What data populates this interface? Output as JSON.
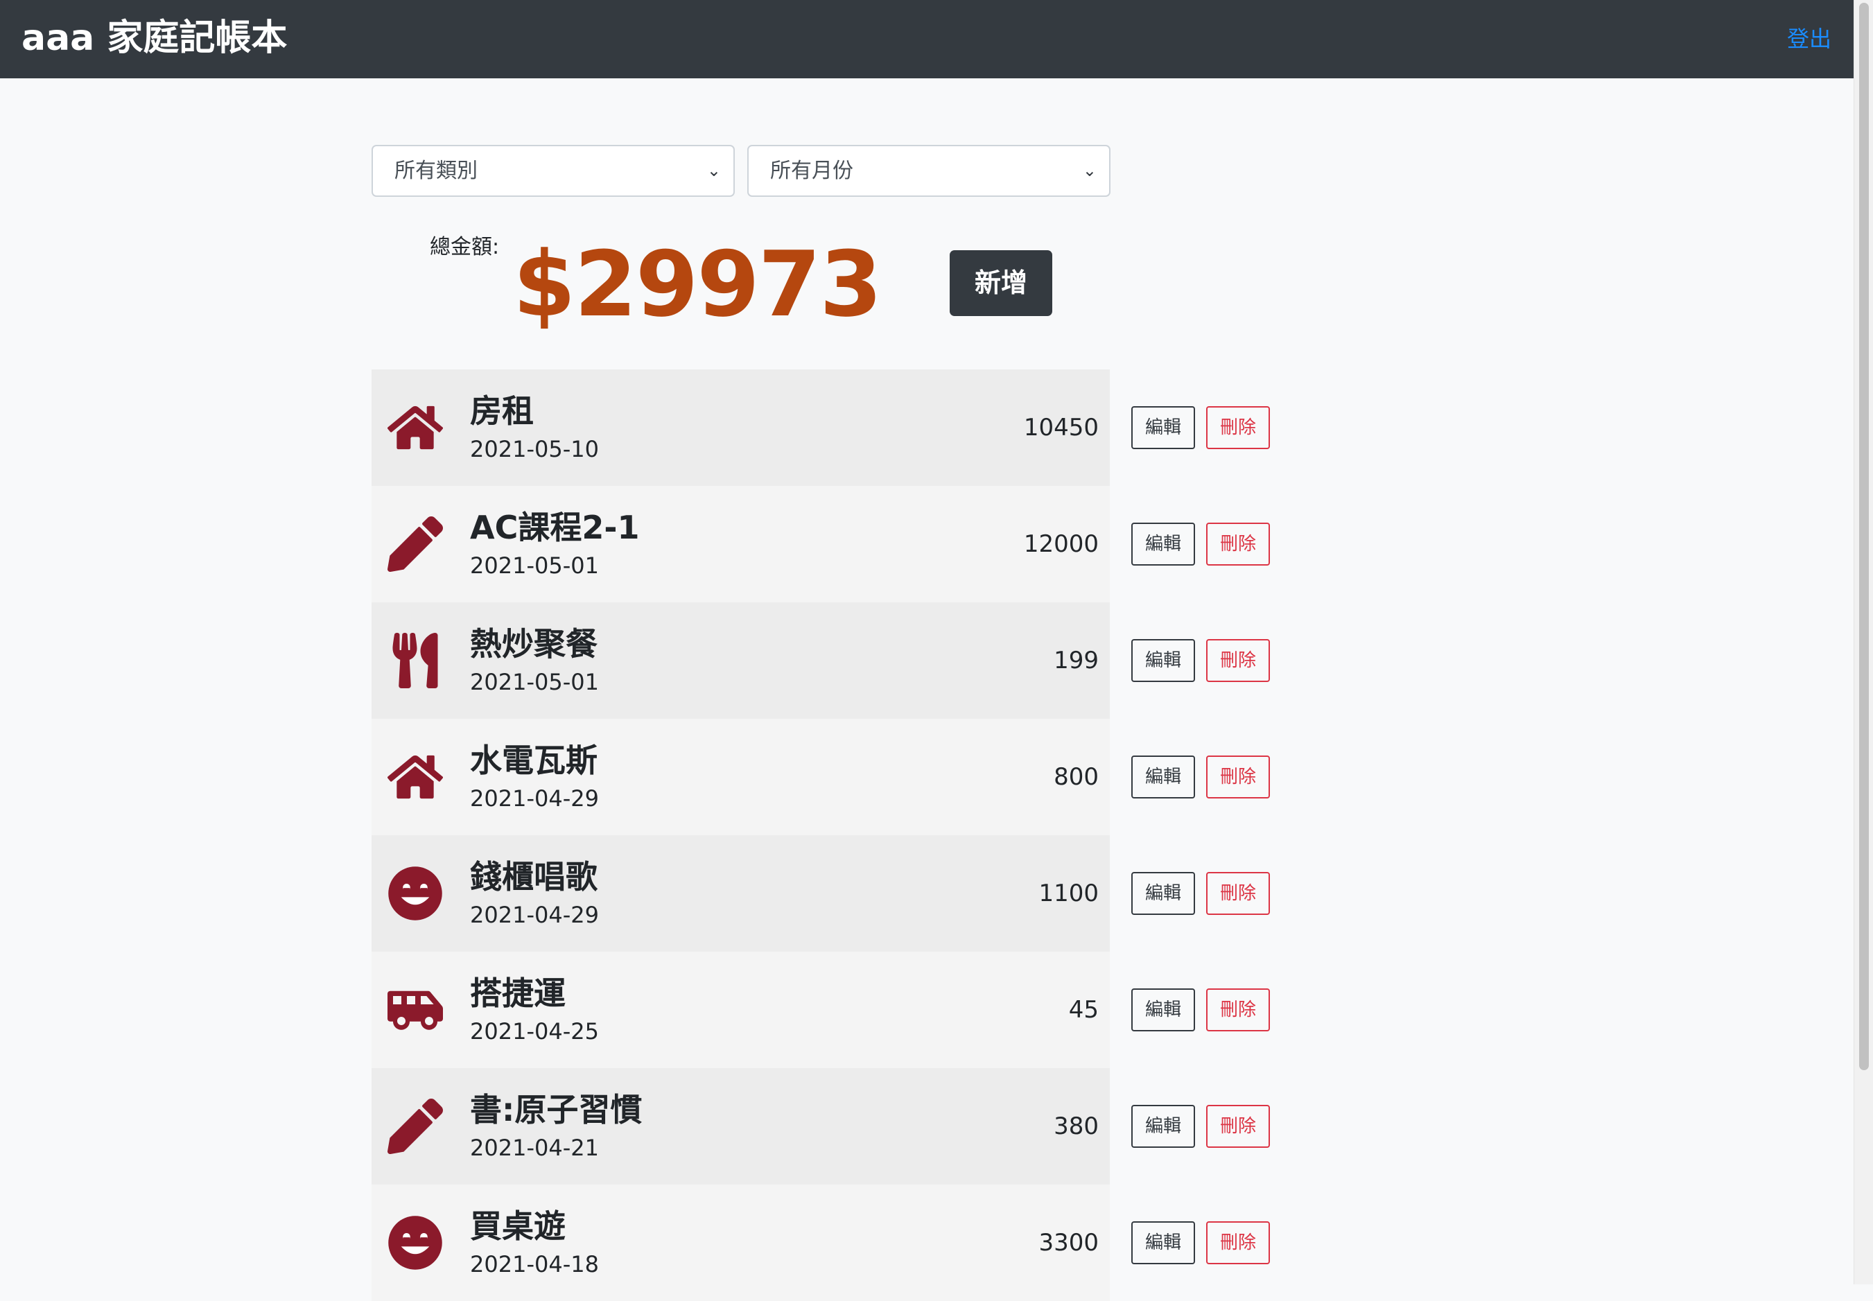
{
  "navbar": {
    "title": "aaa 家庭記帳本",
    "logout_label": "登出"
  },
  "filters": {
    "category": {
      "selected": "所有類別"
    },
    "month": {
      "selected": "所有月份"
    }
  },
  "summary": {
    "total_label": "總金額:",
    "total_amount": "$29973"
  },
  "add_button_label": "新增",
  "colors": {
    "navbar_bg": "#343a40",
    "total_amount": "#b5470f",
    "icon": "#8b1a2b",
    "delete": "#dc3545",
    "logout_link": "#1a8cff"
  },
  "records": [
    {
      "name": "房租",
      "date": "2021-05-10",
      "amount": "10450",
      "icon": "home-icon",
      "edit_label": "編輯",
      "delete_label": "刪除"
    },
    {
      "name": "AC課程2-1",
      "date": "2021-05-01",
      "amount": "12000",
      "icon": "pencil-icon",
      "edit_label": "編輯",
      "delete_label": "刪除"
    },
    {
      "name": "熱炒聚餐",
      "date": "2021-05-01",
      "amount": "199",
      "icon": "utensils-icon",
      "edit_label": "編輯",
      "delete_label": "刪除"
    },
    {
      "name": "水電瓦斯",
      "date": "2021-04-29",
      "amount": "800",
      "icon": "home-icon",
      "edit_label": "編輯",
      "delete_label": "刪除"
    },
    {
      "name": "錢櫃唱歌",
      "date": "2021-04-29",
      "amount": "1100",
      "icon": "smile-icon",
      "edit_label": "編輯",
      "delete_label": "刪除"
    },
    {
      "name": "搭捷運",
      "date": "2021-04-25",
      "amount": "45",
      "icon": "shuttle-van-icon",
      "edit_label": "編輯",
      "delete_label": "刪除"
    },
    {
      "name": "書:原子習慣",
      "date": "2021-04-21",
      "amount": "380",
      "icon": "pencil-icon",
      "edit_label": "編輯",
      "delete_label": "刪除"
    },
    {
      "name": "買桌遊",
      "date": "2021-04-18",
      "amount": "3300",
      "icon": "smile-icon",
      "edit_label": "編輯",
      "delete_label": "刪除"
    }
  ]
}
